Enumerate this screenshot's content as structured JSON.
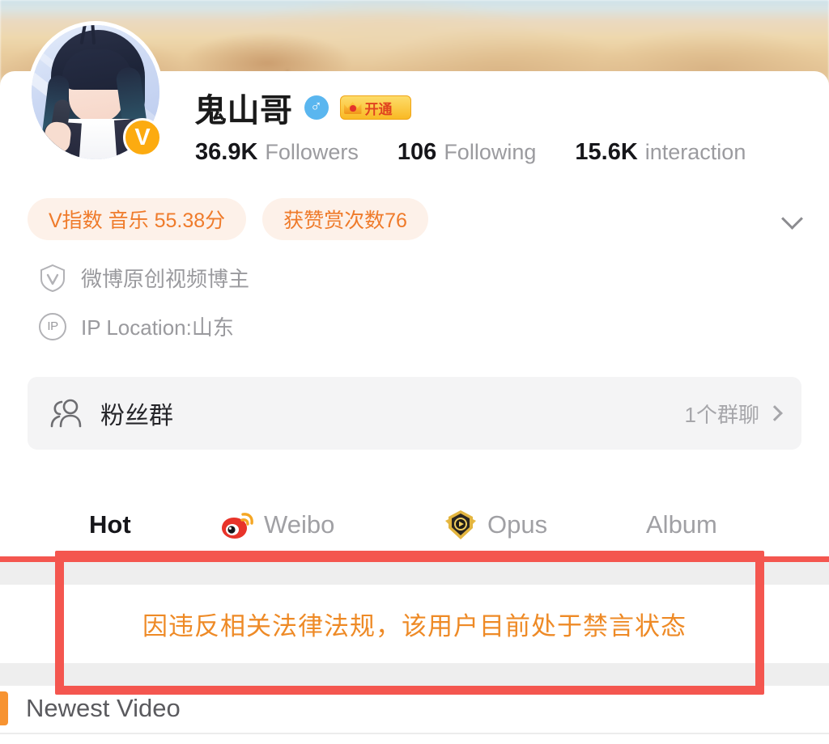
{
  "profile": {
    "display_name": "鬼山哥",
    "gender_icon": "male-symbol",
    "gender_glyph": "♂",
    "vip_badge_label": "开通",
    "verified_badge_letter": "V",
    "avatar_alt": "anime-avatar"
  },
  "stats": [
    {
      "value": "36.9K",
      "label": "Followers"
    },
    {
      "value": "106",
      "label": "Following"
    },
    {
      "value": "15.6K",
      "label": "interaction"
    }
  ],
  "pills": [
    {
      "text": "V指数 音乐 55.38分"
    },
    {
      "text": "获赞赏次数76"
    }
  ],
  "expand": {
    "icon": "chevron-down-icon"
  },
  "info": [
    {
      "icon": "shield-v-icon",
      "text": "微博原创视频博主"
    },
    {
      "icon": "ip-location-icon",
      "text": "IP Location:山东"
    }
  ],
  "fan_group": {
    "icon": "people-icon",
    "title": "粉丝群",
    "meta": "1个群聊",
    "chevron": "chevron-right-icon"
  },
  "tabs": [
    {
      "label": "Hot",
      "icon": null,
      "active": true
    },
    {
      "label": "Weibo",
      "icon": "weibo-eye-icon",
      "active": false
    },
    {
      "label": "Opus",
      "icon": "opus-shield-icon",
      "active": false
    },
    {
      "label": "Album",
      "icon": null,
      "active": false
    }
  ],
  "notice": {
    "text": "因违反相关法律法规，该用户目前处于禁言状态"
  },
  "footer": {
    "newest_video_label": "Newest Video"
  },
  "colors": {
    "accent_orange": "#ef7b2b",
    "notice_orange": "#ee8a26",
    "annotation_red": "#f4564f",
    "tab_indicator_red": "#f4564f",
    "verified_yellow": "#fcab10",
    "gender_blue": "#5ab6ef",
    "pill_bg": "#fdf1e9"
  }
}
